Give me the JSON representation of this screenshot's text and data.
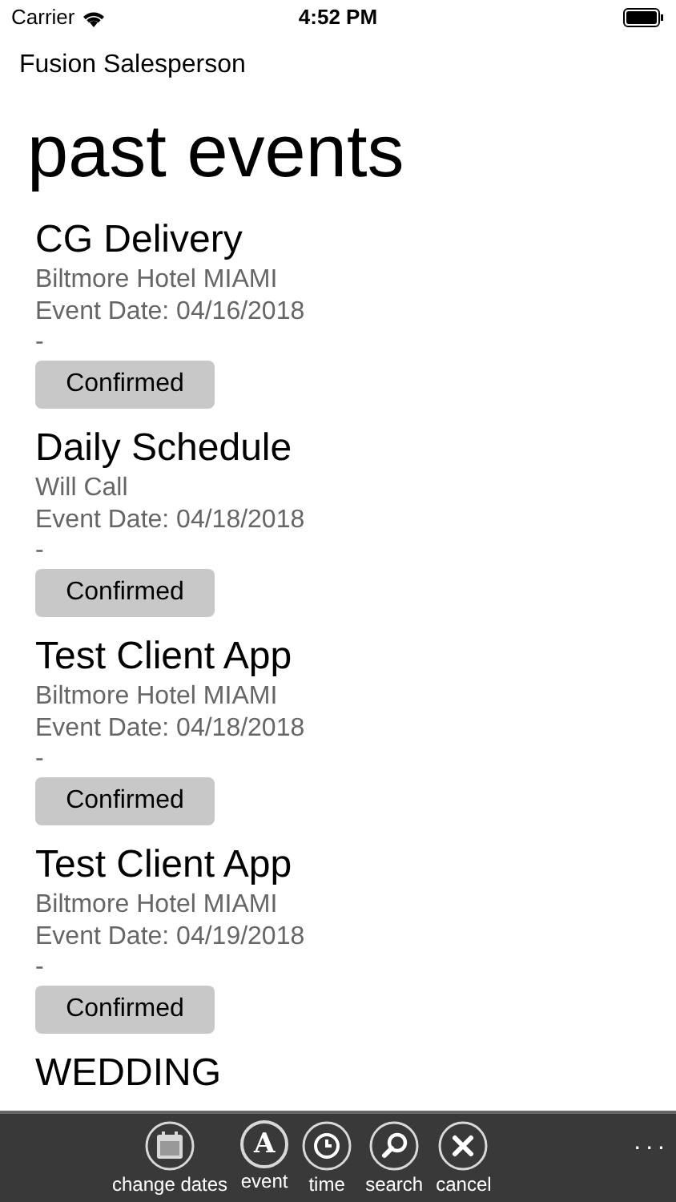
{
  "status_bar": {
    "carrier": "Carrier",
    "time": "4:52 PM"
  },
  "app_title": "Fusion Salesperson",
  "heading": "past events",
  "events": [
    {
      "title": "CG Delivery",
      "venue": "Biltmore Hotel MIAMI",
      "date": "Event Date: 04/16/2018",
      "note": "-",
      "status": "Confirmed"
    },
    {
      "title": "Daily Schedule",
      "venue": "Will Call",
      "date": "Event Date: 04/18/2018",
      "note": "-",
      "status": "Confirmed"
    },
    {
      "title": "Test Client App",
      "venue": "Biltmore Hotel MIAMI",
      "date": "Event Date: 04/18/2018",
      "note": "-",
      "status": "Confirmed"
    },
    {
      "title": "Test Client App",
      "venue": "Biltmore Hotel MIAMI",
      "date": "Event Date: 04/19/2018",
      "note": "-",
      "status": "Confirmed"
    },
    {
      "title": "WEDDING"
    }
  ],
  "toolbar": [
    {
      "kind": "calendar",
      "label": "change dates"
    },
    {
      "kind": "letter",
      "glyph": "A",
      "label": "event"
    },
    {
      "kind": "clock",
      "label": "time"
    },
    {
      "kind": "search",
      "label": "search"
    },
    {
      "kind": "cancel",
      "label": "cancel"
    }
  ],
  "more": "..."
}
